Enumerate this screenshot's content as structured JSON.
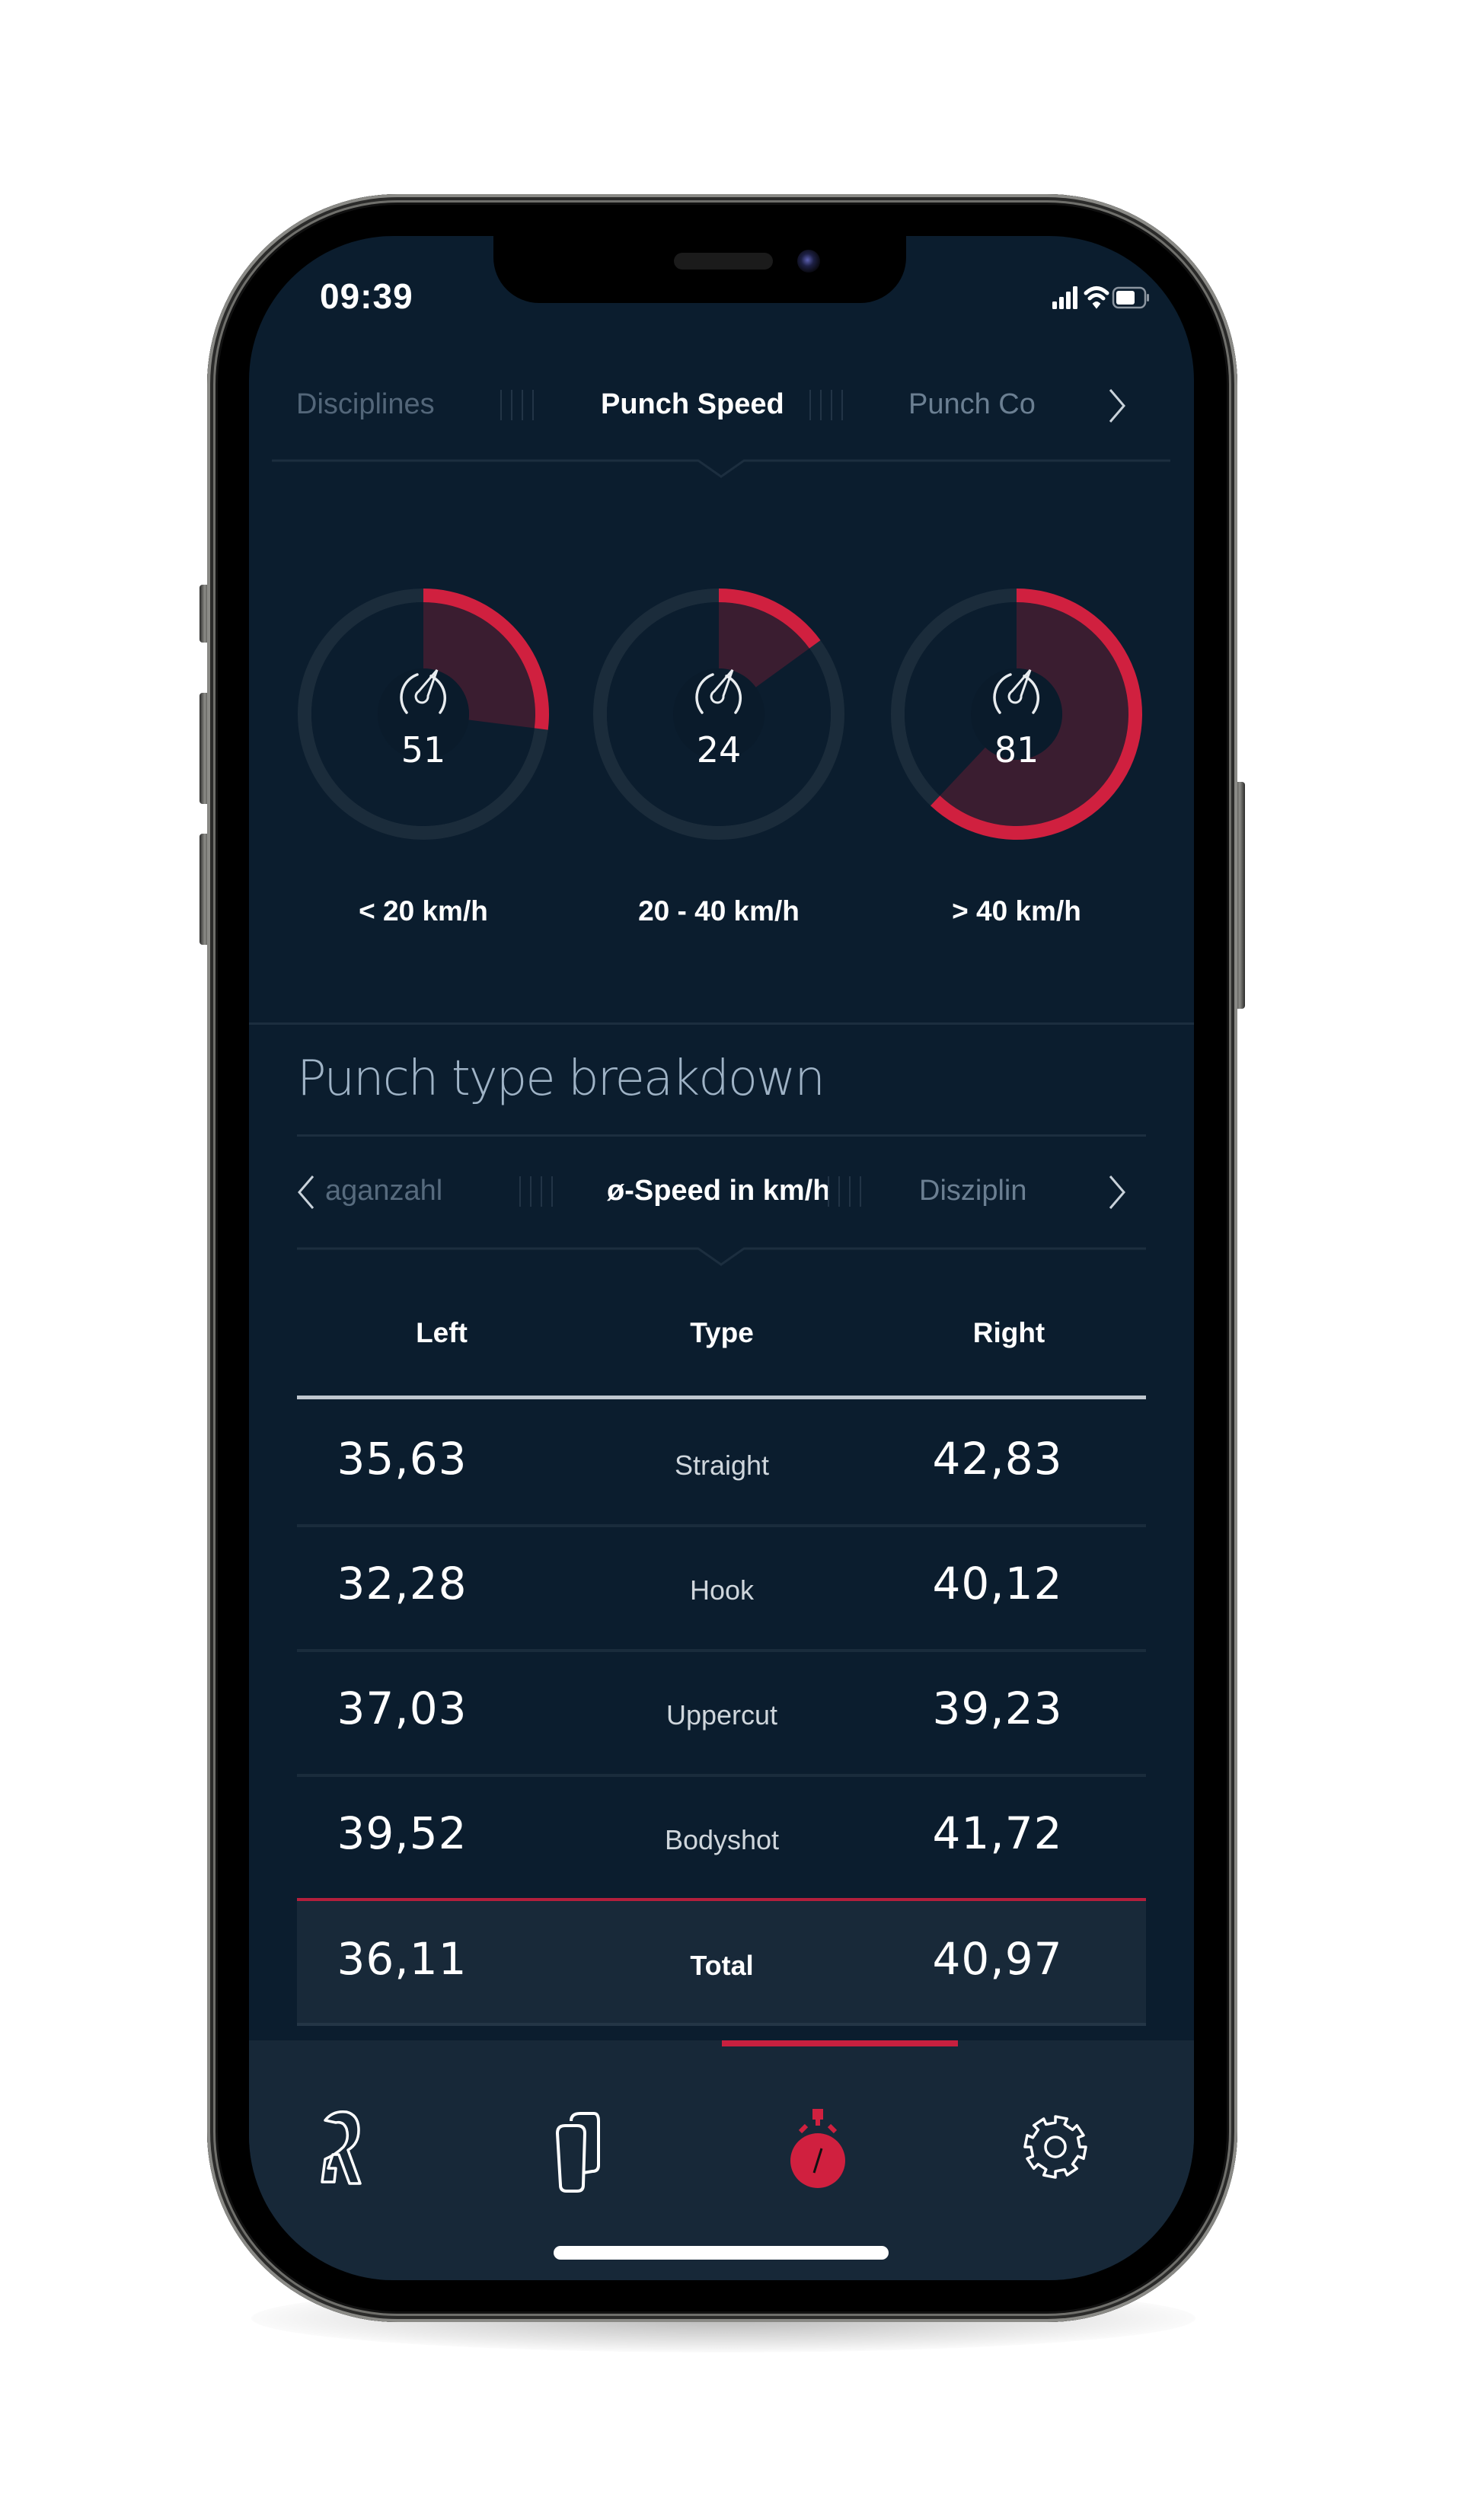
{
  "status_bar": {
    "time": "09:39"
  },
  "top_tabs": {
    "items": [
      {
        "label": "Disciplines",
        "state": "previous"
      },
      {
        "label": "Punch Speed",
        "state": "active"
      },
      {
        "label": "Punch Co",
        "state": "next"
      }
    ],
    "next_icon": "chevron-right-icon"
  },
  "gauges": [
    {
      "value": "51",
      "label": "< 20 km/h",
      "fill_fraction": 0.27,
      "icon": "speedometer-icon"
    },
    {
      "value": "24",
      "label": "20 - 40 km/h",
      "fill_fraction": 0.15,
      "icon": "speedometer-icon"
    },
    {
      "value": "81",
      "label": "> 40 km/h",
      "fill_fraction": 0.62,
      "icon": "speedometer-icon"
    }
  ],
  "breakdown": {
    "title": "Punch type breakdown",
    "tabs": [
      {
        "label": "aganzahl",
        "state": "previous"
      },
      {
        "label": "ø-Speed in km/h",
        "state": "active"
      },
      {
        "label": "Disziplin",
        "state": "next"
      }
    ],
    "prev_icon": "chevron-left-icon",
    "next_icon": "chevron-right-icon",
    "columns": [
      "Left",
      "Type",
      "Right"
    ],
    "rows": [
      {
        "left": "35,63",
        "type": "Straight",
        "right": "42,83"
      },
      {
        "left": "32,28",
        "type": "Hook",
        "right": "40,12"
      },
      {
        "left": "37,03",
        "type": "Uppercut",
        "right": "39,23"
      },
      {
        "left": "39,52",
        "type": "Bodyshot",
        "right": "41,72"
      }
    ],
    "total": {
      "left": "36,11",
      "type": "Total",
      "right": "40,97"
    }
  },
  "bottom_nav": {
    "items": [
      {
        "icon": "brand-logo-icon",
        "active": false
      },
      {
        "icon": "gloves-icon",
        "active": false
      },
      {
        "icon": "stopwatch-icon",
        "active": true
      },
      {
        "icon": "gear-icon",
        "active": false
      }
    ]
  },
  "colors": {
    "background": "#0b1d2e",
    "accent": "#d0203f",
    "gauge_fill": "#3a1d30",
    "gauge_track": "#1b2c3b",
    "nav_background": "#172838",
    "heading": "#9fb3c6"
  }
}
